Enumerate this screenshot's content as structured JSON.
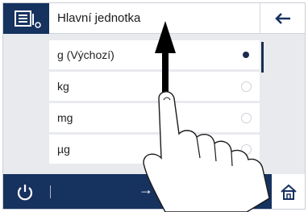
{
  "header": {
    "title": "Hlavní jednotka",
    "menu_icon": "settings-list-icon",
    "back_icon": "arrow-left-icon"
  },
  "units": [
    {
      "label": "g (Výchozí)",
      "selected": true
    },
    {
      "label": "kg",
      "selected": false
    },
    {
      "label": "mg",
      "selected": false
    },
    {
      "label": "µg",
      "selected": false
    }
  ],
  "footer": {
    "power_icon": "power-icon",
    "transfer_label": "→T",
    "home_icon": "home-icon"
  },
  "overlay": {
    "gesture": "swipe-up-hand",
    "arrow": "arrow-up-icon"
  },
  "colors": {
    "navy": "#16325f",
    "background": "#e8eaee",
    "selected_dot": "#1b2c4d"
  }
}
